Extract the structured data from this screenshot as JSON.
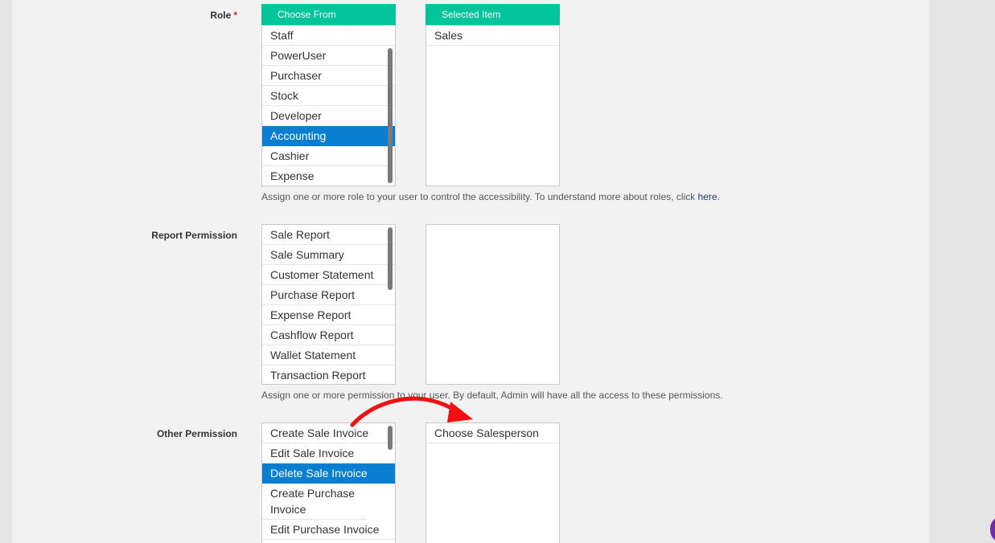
{
  "role": {
    "label": "Role",
    "required_mark": "*",
    "choose_header": "Choose From",
    "selected_header": "Selected Item",
    "options": [
      "Staff",
      "PowerUser",
      "Purchaser",
      "Stock",
      "Developer",
      "Accounting",
      "Cashier",
      "Expense"
    ],
    "selected_option": "Accounting",
    "selected_items": [
      "Sales"
    ],
    "hint_text": "Assign one or more role to your user to control the accessibility. To understand more about roles, click ",
    "hint_link": "here",
    "hint_end": "."
  },
  "report_permission": {
    "label": "Report Permission",
    "options": [
      "Sale Report",
      "Sale Summary",
      "Customer Statement",
      "Purchase Report",
      "Expense Report",
      "Cashflow Report",
      "Wallet Statement",
      "Transaction Report"
    ],
    "selected_items": [],
    "hint_text": "Assign one or more permission to your user. By default, Admin will have all the access to these permissions."
  },
  "other_permission": {
    "label": "Other Permission",
    "options": [
      "Create Sale Invoice",
      "Edit Sale Invoice",
      "Delete Sale Invoice",
      "Create Purchase Invoice",
      "Edit Purchase Invoice"
    ],
    "selected_option": "Delete Sale Invoice",
    "selected_items": [
      "Choose Salesperson"
    ]
  },
  "colors": {
    "header_green": "#00c49a",
    "selection_blue": "#0a7fd1",
    "annotation_red": "#f01010"
  },
  "icons": {
    "annotation": "red-curved-arrow-icon"
  }
}
